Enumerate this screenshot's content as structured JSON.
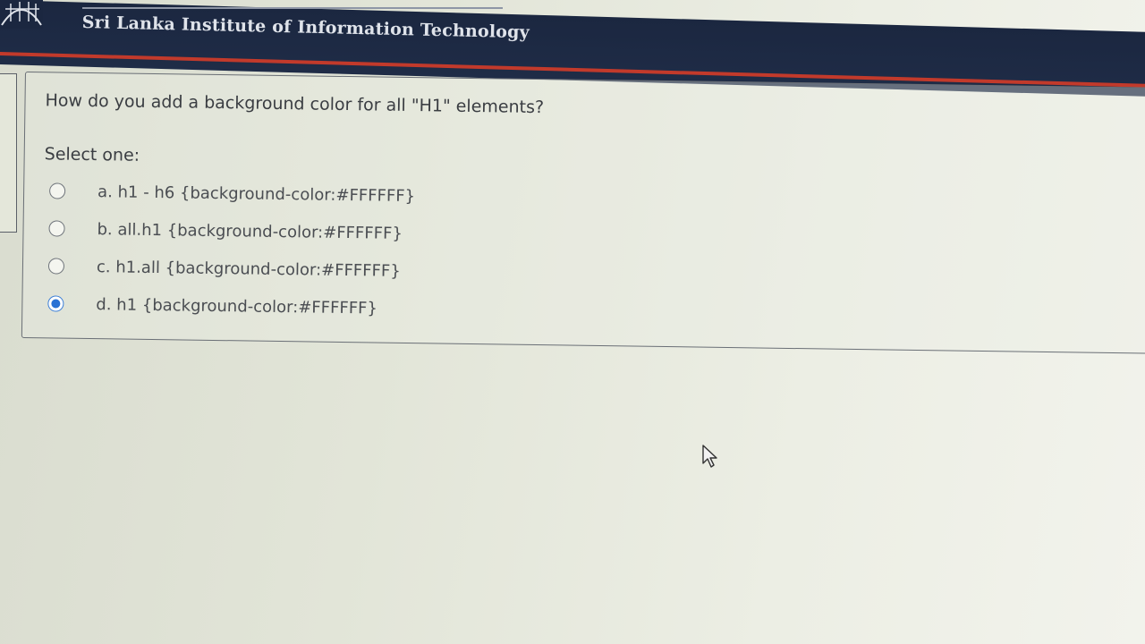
{
  "header": {
    "institution_name": "Sri Lanka Institute of Information Technology"
  },
  "question": {
    "text": "How do you add a background color for all \"H1\" elements?",
    "select_label": "Select one:",
    "options": [
      {
        "label": "a. h1 - h6 {background-color:#FFFFFF}",
        "selected": false
      },
      {
        "label": "b. all.h1 {background-color:#FFFFFF}",
        "selected": false
      },
      {
        "label": "c. h1.all {background-color:#FFFFFF}",
        "selected": false
      },
      {
        "label": "d. h1 {background-color:#FFFFFF}",
        "selected": true
      }
    ]
  },
  "colors": {
    "header_bg": "#1b2740",
    "accent_line": "#c23a2b",
    "radio_selected": "#2a72d4"
  },
  "icons": {
    "logo": "slit-logo-icon",
    "cursor": "mouse-pointer-icon"
  }
}
